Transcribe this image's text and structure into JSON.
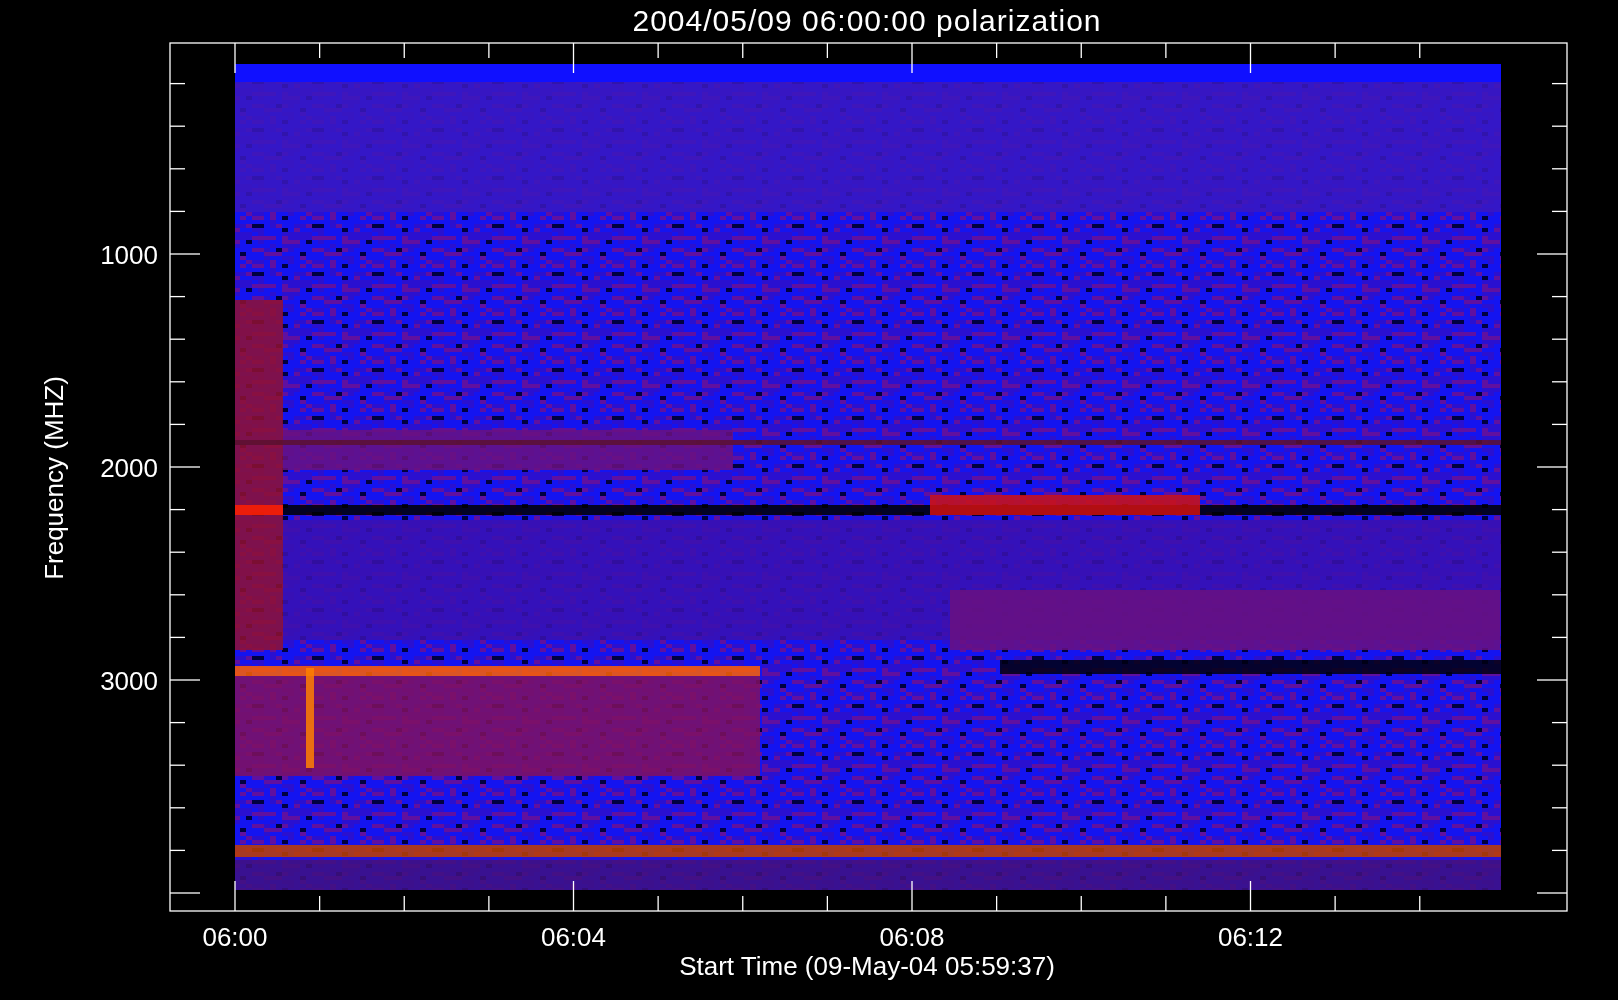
{
  "title": "2004/05/09 06:00:00 polarization",
  "y_axis": {
    "label": "Frequency (MHZ)",
    "ticks": [
      "1000",
      "2000",
      "3000"
    ]
  },
  "x_axis": {
    "label": "Start Time (09-May-04 05:59:37)",
    "ticks": [
      "06:00",
      "06:04",
      "06:08",
      "06:12"
    ]
  }
}
